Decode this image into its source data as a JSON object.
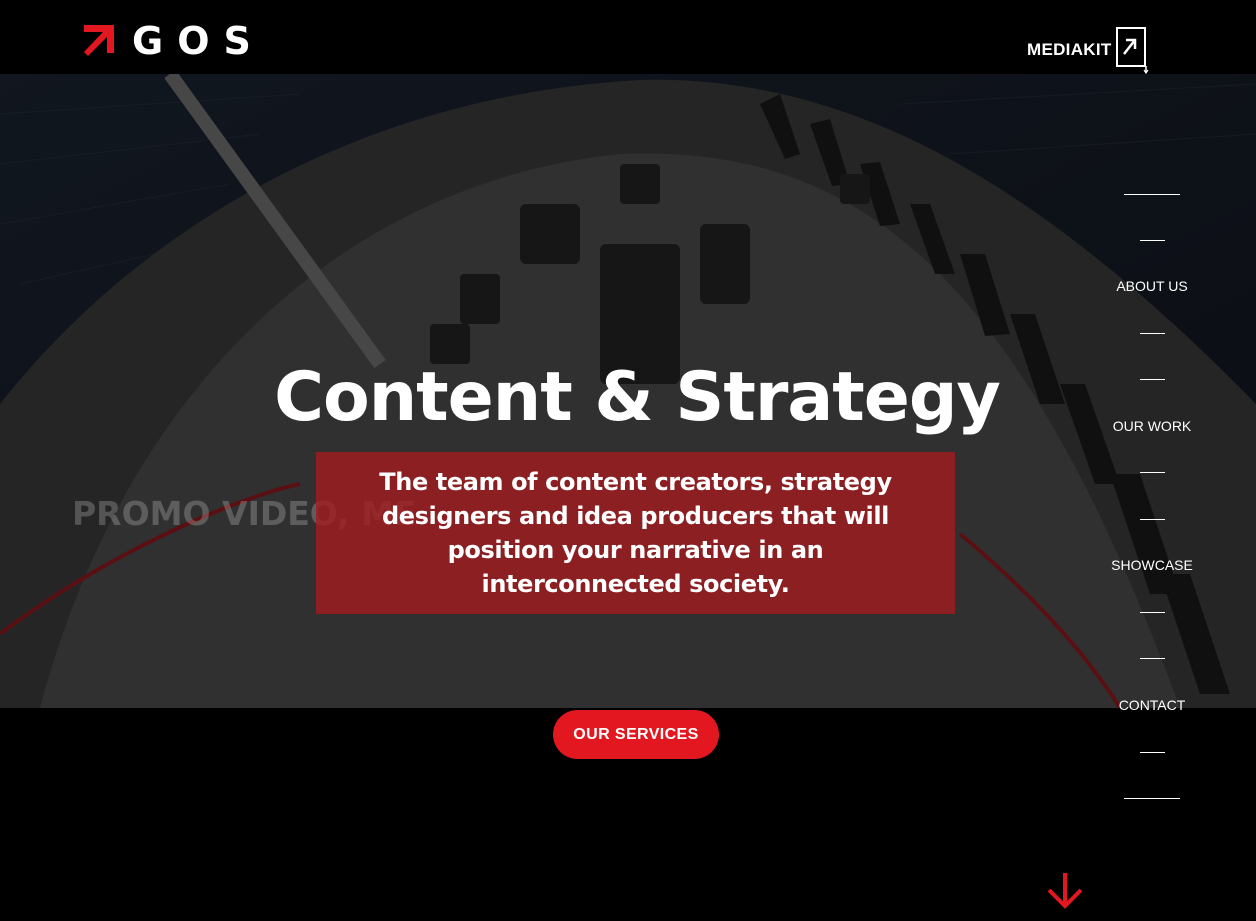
{
  "brand": {
    "name": "GOS",
    "accent_color": "#e3171f"
  },
  "header": {
    "mediakit_label": "MEDIAKIT",
    "mediakit_icon": "download-arrow-icon"
  },
  "hero": {
    "headline": "Content & Strategy",
    "tagline": "The team of content creators, strategy designers and idea producers that will position your narrative in an interconnected society.",
    "promo_text": "PROMO VIDEO, ME",
    "cta_label": "OUR SERVICES",
    "tag_box_color": "#a01c20"
  },
  "nav": {
    "items": [
      {
        "label": "ABOUT US"
      },
      {
        "label": "OUR WORK"
      },
      {
        "label": "SHOWCASE"
      },
      {
        "label": "CONTACT"
      }
    ]
  },
  "scroll_icon": "chevron-down-arrow-icon"
}
